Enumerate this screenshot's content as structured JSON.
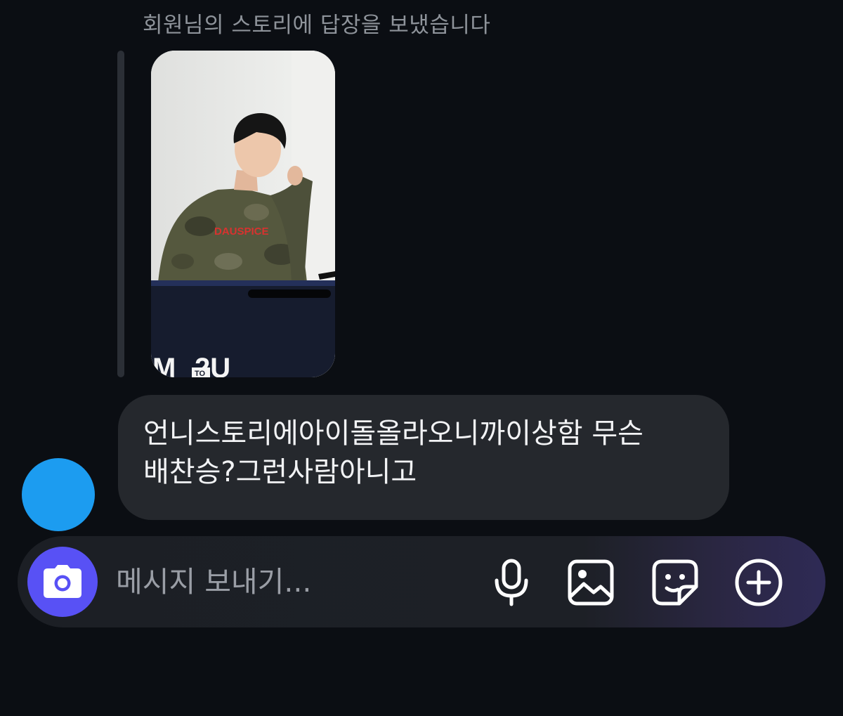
{
  "thread": {
    "reply_caption": "회원님의 스토리에 답장을 보냈습니다",
    "story": {
      "image_alt": "story photo of a person in a camouflage long-sleeve shirt",
      "shirt_text": "DAUSPICE"
    },
    "message": {
      "line1": "언니스토리에아이돌올라오니까이상함 무슨",
      "line2": "배찬승?그런사람아니고"
    },
    "avatar_color": "#1c9cf0"
  },
  "composer": {
    "placeholder": "메시지 보내기...",
    "accent_color": "#5851f5",
    "icons": [
      "camera-icon",
      "microphone-icon",
      "gallery-icon",
      "sticker-icon",
      "plus-circle-icon"
    ]
  }
}
